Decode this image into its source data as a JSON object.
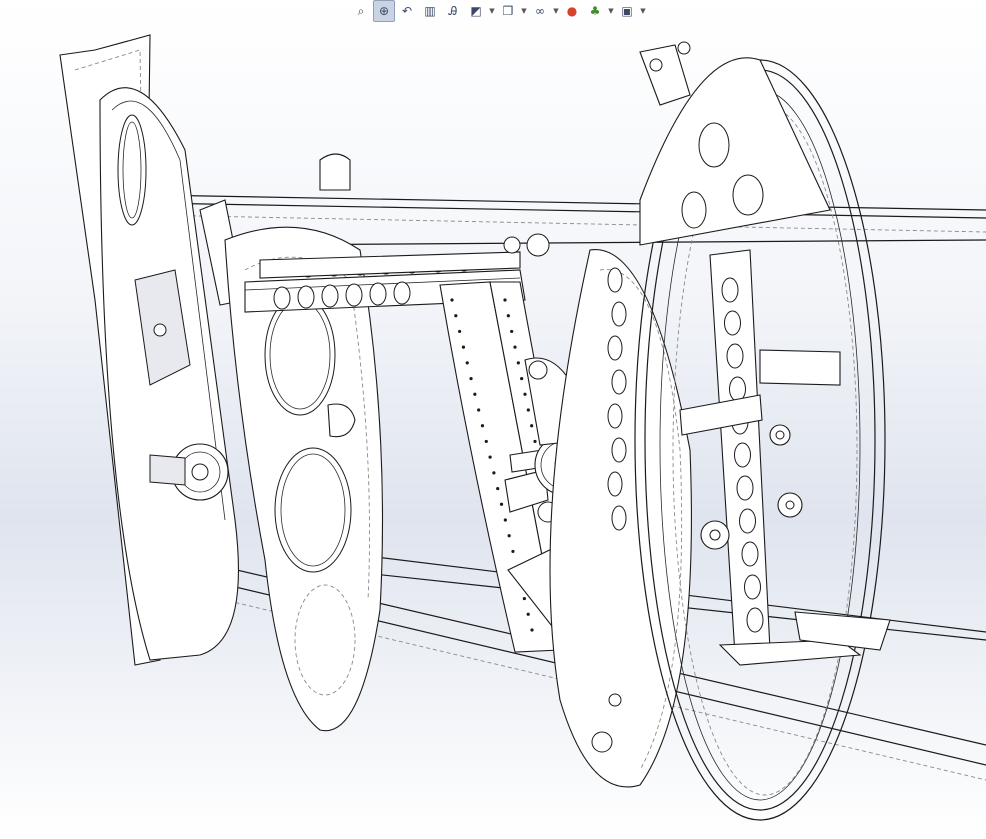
{
  "window": {
    "title": ""
  },
  "toolbar": {
    "buttons": [
      {
        "name": "zoom-to-fit-button",
        "icon": "zoom-to-fit-icon",
        "glyph": "⌕",
        "active": false,
        "dropdown": false
      },
      {
        "name": "zoom-to-area-button",
        "icon": "zoom-to-area-icon",
        "glyph": "⊕",
        "active": true,
        "dropdown": false
      },
      {
        "name": "previous-view-button",
        "icon": "previous-view-icon",
        "glyph": "↶",
        "active": false,
        "dropdown": false
      },
      {
        "name": "section-view-button",
        "icon": "section-view-icon",
        "glyph": "▥",
        "active": false,
        "dropdown": false
      },
      {
        "name": "dynamic-annotation-views-button",
        "icon": "dynamic-annotation-icon",
        "glyph": "Ꭿ",
        "active": false,
        "dropdown": false
      },
      {
        "name": "view-orientation-button",
        "icon": "view-orientation-icon",
        "glyph": "◩",
        "active": false,
        "dropdown": true
      },
      {
        "name": "display-style-button",
        "icon": "display-style-icon",
        "glyph": "❒",
        "active": false,
        "dropdown": true
      },
      {
        "name": "hide-show-items-button",
        "icon": "hide-show-icon",
        "glyph": "∞",
        "active": false,
        "dropdown": true
      },
      {
        "name": "edit-appearance-button",
        "icon": "appearance-sphere-icon",
        "glyph": "●",
        "active": false,
        "dropdown": false
      },
      {
        "name": "apply-scene-button",
        "icon": "scene-icon",
        "glyph": "♣",
        "active": false,
        "dropdown": true
      },
      {
        "name": "view-settings-button",
        "icon": "view-settings-icon",
        "glyph": "▣",
        "active": false,
        "dropdown": true
      }
    ]
  },
  "model": {
    "display_style": "hidden lines visible",
    "icon": "cad-assembly-icon"
  },
  "colors": {
    "line": "#1b1b1b",
    "hidden_line": "#8a8a8a",
    "background_top": "#ffffff",
    "background_mid": "#dfe4ee",
    "toolbar_active": "#c9d3e3",
    "appearance_sphere": "#d9412b",
    "scene_icon": "#3e8a2e"
  }
}
